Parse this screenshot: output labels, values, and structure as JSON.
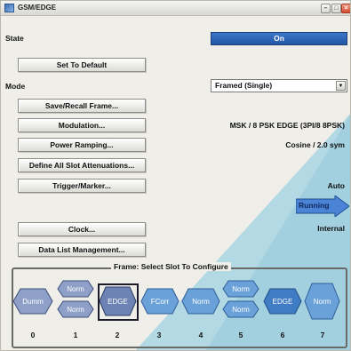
{
  "window": {
    "title": "GSM/EDGE"
  },
  "state": {
    "label": "State",
    "value": "On"
  },
  "buttons": {
    "set_default": "Set To Default",
    "save_recall": "Save/Recall Frame...",
    "modulation": "Modulation...",
    "power_ramping": "Power Ramping...",
    "slot_attenuations": "Define All Slot Attenuations...",
    "trigger_marker": "Trigger/Marker...",
    "clock": "Clock...",
    "data_list": "Data List Management..."
  },
  "mode": {
    "label": "Mode",
    "selected": "Framed (Single)"
  },
  "values": {
    "modulation": "MSK / 8 PSK EDGE (3PI/8 8PSK)",
    "power_ramping": "Cosine / 2.0 sym",
    "trigger": "Auto",
    "running": "Running",
    "clock": "Internal"
  },
  "frame": {
    "title": "Frame: Select Slot To Configure",
    "slots": [
      {
        "number": "0",
        "labels": [
          "Dumm"
        ]
      },
      {
        "number": "1",
        "labels": [
          "Norm",
          "Norm"
        ]
      },
      {
        "number": "2",
        "labels": [
          "EDGE"
        ],
        "selected": true
      },
      {
        "number": "3",
        "labels": [
          "FCorr"
        ]
      },
      {
        "number": "4",
        "labels": [
          "Norm"
        ]
      },
      {
        "number": "5",
        "labels": [
          "Norm",
          "Norm"
        ]
      },
      {
        "number": "6",
        "labels": [
          "EDGE"
        ]
      },
      {
        "number": "7",
        "labels": [
          "Norm"
        ]
      }
    ]
  },
  "colors": {
    "on_button": "#2f63b5",
    "slot_fill_gray": "#8a98c2",
    "slot_fill_blue": "#5b8fd0",
    "slot_selected": "#3f5a8c",
    "diagonal_overlay": "#8fc6d8"
  }
}
